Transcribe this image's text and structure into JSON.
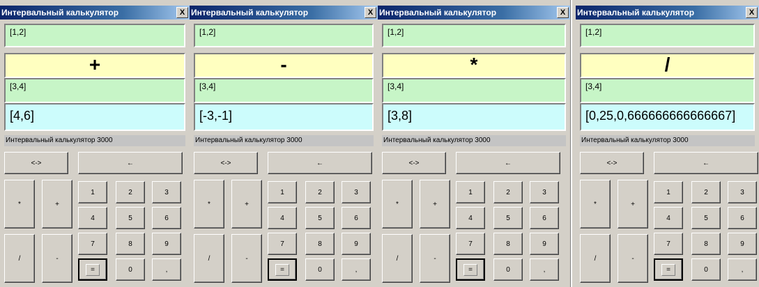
{
  "windows": [
    {
      "title": "Интервальный калькулятор",
      "close": "X",
      "operand_a": "[1,2]",
      "operator": "+",
      "operand_b": "[3,4]",
      "result": "[4,6]",
      "status": "Интервальный калькулятор 3000"
    },
    {
      "title": "Интервальный калькулятор",
      "close": "X",
      "operand_a": "[1,2]",
      "operator": "-",
      "operand_b": "[3,4]",
      "result": "[-3,-1]",
      "status": "Интервальный калькулятор 3000"
    },
    {
      "title": "Интервальный калькулятор",
      "close": "X",
      "operand_a": "[1,2]",
      "operator": "*",
      "operand_b": "[3,4]",
      "result": "[3,8]",
      "status": "Интервальный калькулятор 3000"
    },
    {
      "title": "Интервальный калькулятор",
      "close": "X",
      "operand_a": "[1,2]",
      "operator": "/",
      "operand_b": "[3,4]",
      "result": "[0,25,0,666666666666667]",
      "status": "Интервальный калькулятор 3000"
    }
  ],
  "buttons": {
    "swap": "<->",
    "backspace": "←",
    "multiply": "*",
    "plus": "+",
    "divide": "/",
    "minus": "-",
    "d1": "1",
    "d2": "2",
    "d3": "3",
    "d4": "4",
    "d5": "5",
    "d6": "6",
    "d7": "7",
    "d8": "8",
    "d9": "9",
    "equals": "=",
    "d0": "0",
    "comma": ","
  }
}
